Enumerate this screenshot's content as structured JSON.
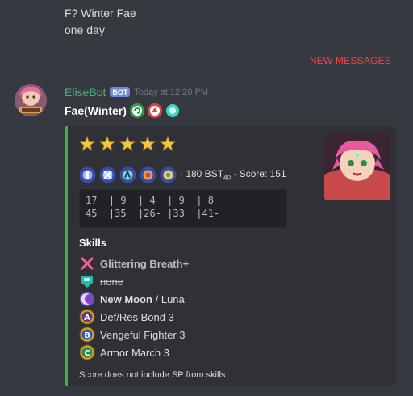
{
  "previous_message": {
    "line1": "F? Winter Fae",
    "line2": "one day"
  },
  "divider": {
    "label": "NEW MESSAGES"
  },
  "message": {
    "username": "EliseBot",
    "bot_tag": "BOT",
    "timestamp": "Today at 12:20 PM",
    "unit_title": "Fae(Winter)",
    "title_emojis": [
      "green-magic-icon",
      "dragon-icon",
      "cyan-orb-icon"
    ]
  },
  "embed": {
    "accent_color": "#3fb43f",
    "rarity_stars": 5,
    "stat_icons": [
      "hp-icon",
      "attack-icon",
      "speed-icon",
      "defense-icon",
      "resistance-icon"
    ],
    "stats_summary_prefix": "· 180 BST",
    "stats_summary_sub": "40",
    "stats_summary_suffix": " · Score: 151",
    "stats_block_line1": "17  | 9  | 4  | 9  | 8",
    "stats_block_line2": "45  |35  |26- |33  |41-",
    "skills_title": "Skills",
    "skills": {
      "weapon": "Glittering Breath+",
      "assist": "none",
      "special_name": "New Moon",
      "special_sep": " / ",
      "special_alt": "Luna",
      "a": "Def/Res Bond 3",
      "b": "Vengeful Fighter 3",
      "c": "Armor March 3"
    },
    "footer": "Score does not include SP from skills"
  }
}
